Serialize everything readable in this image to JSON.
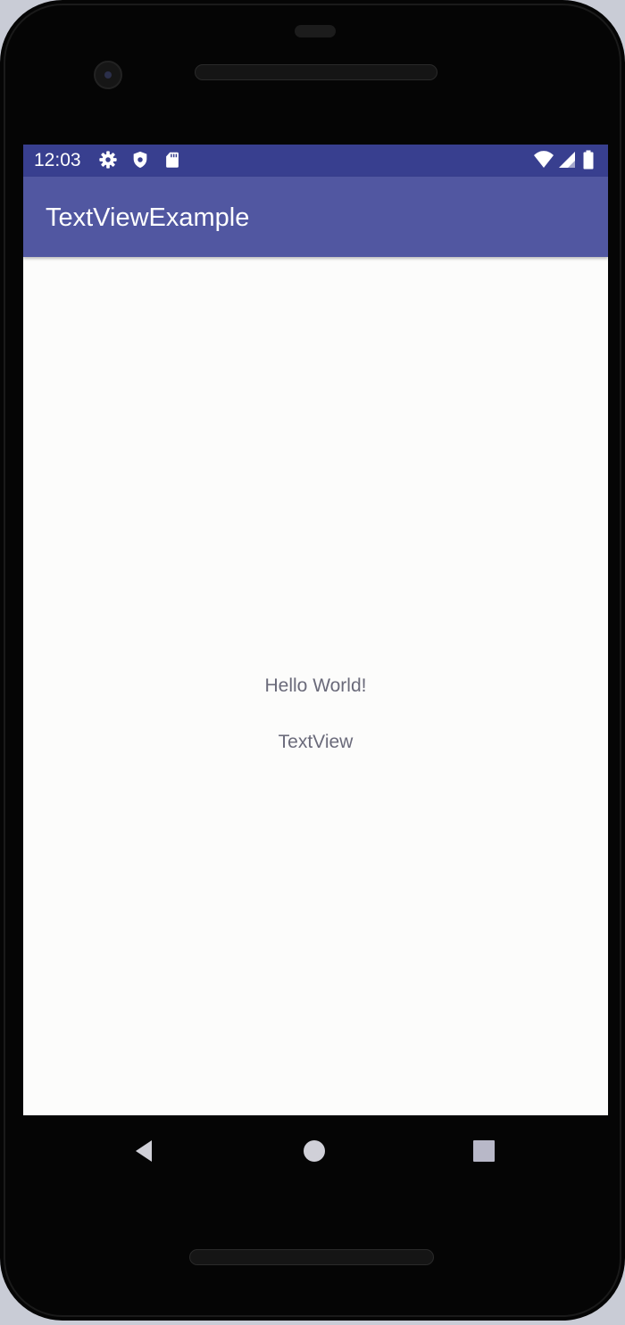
{
  "status_bar": {
    "time": "12:03",
    "left_icons": [
      "gear-icon",
      "shield-icon",
      "sd-card-icon"
    ],
    "right_icons": [
      "wifi-icon",
      "signal-icon",
      "battery-icon"
    ],
    "background_color": "#383f8f"
  },
  "app_bar": {
    "title": "TextViewExample",
    "background_color": "#5157a1"
  },
  "content": {
    "text_1": "Hello World!",
    "text_2": "TextView",
    "background_color": "#fcfcfb"
  },
  "nav_bar": {
    "buttons": [
      "back-icon",
      "home-icon",
      "recents-icon"
    ]
  }
}
